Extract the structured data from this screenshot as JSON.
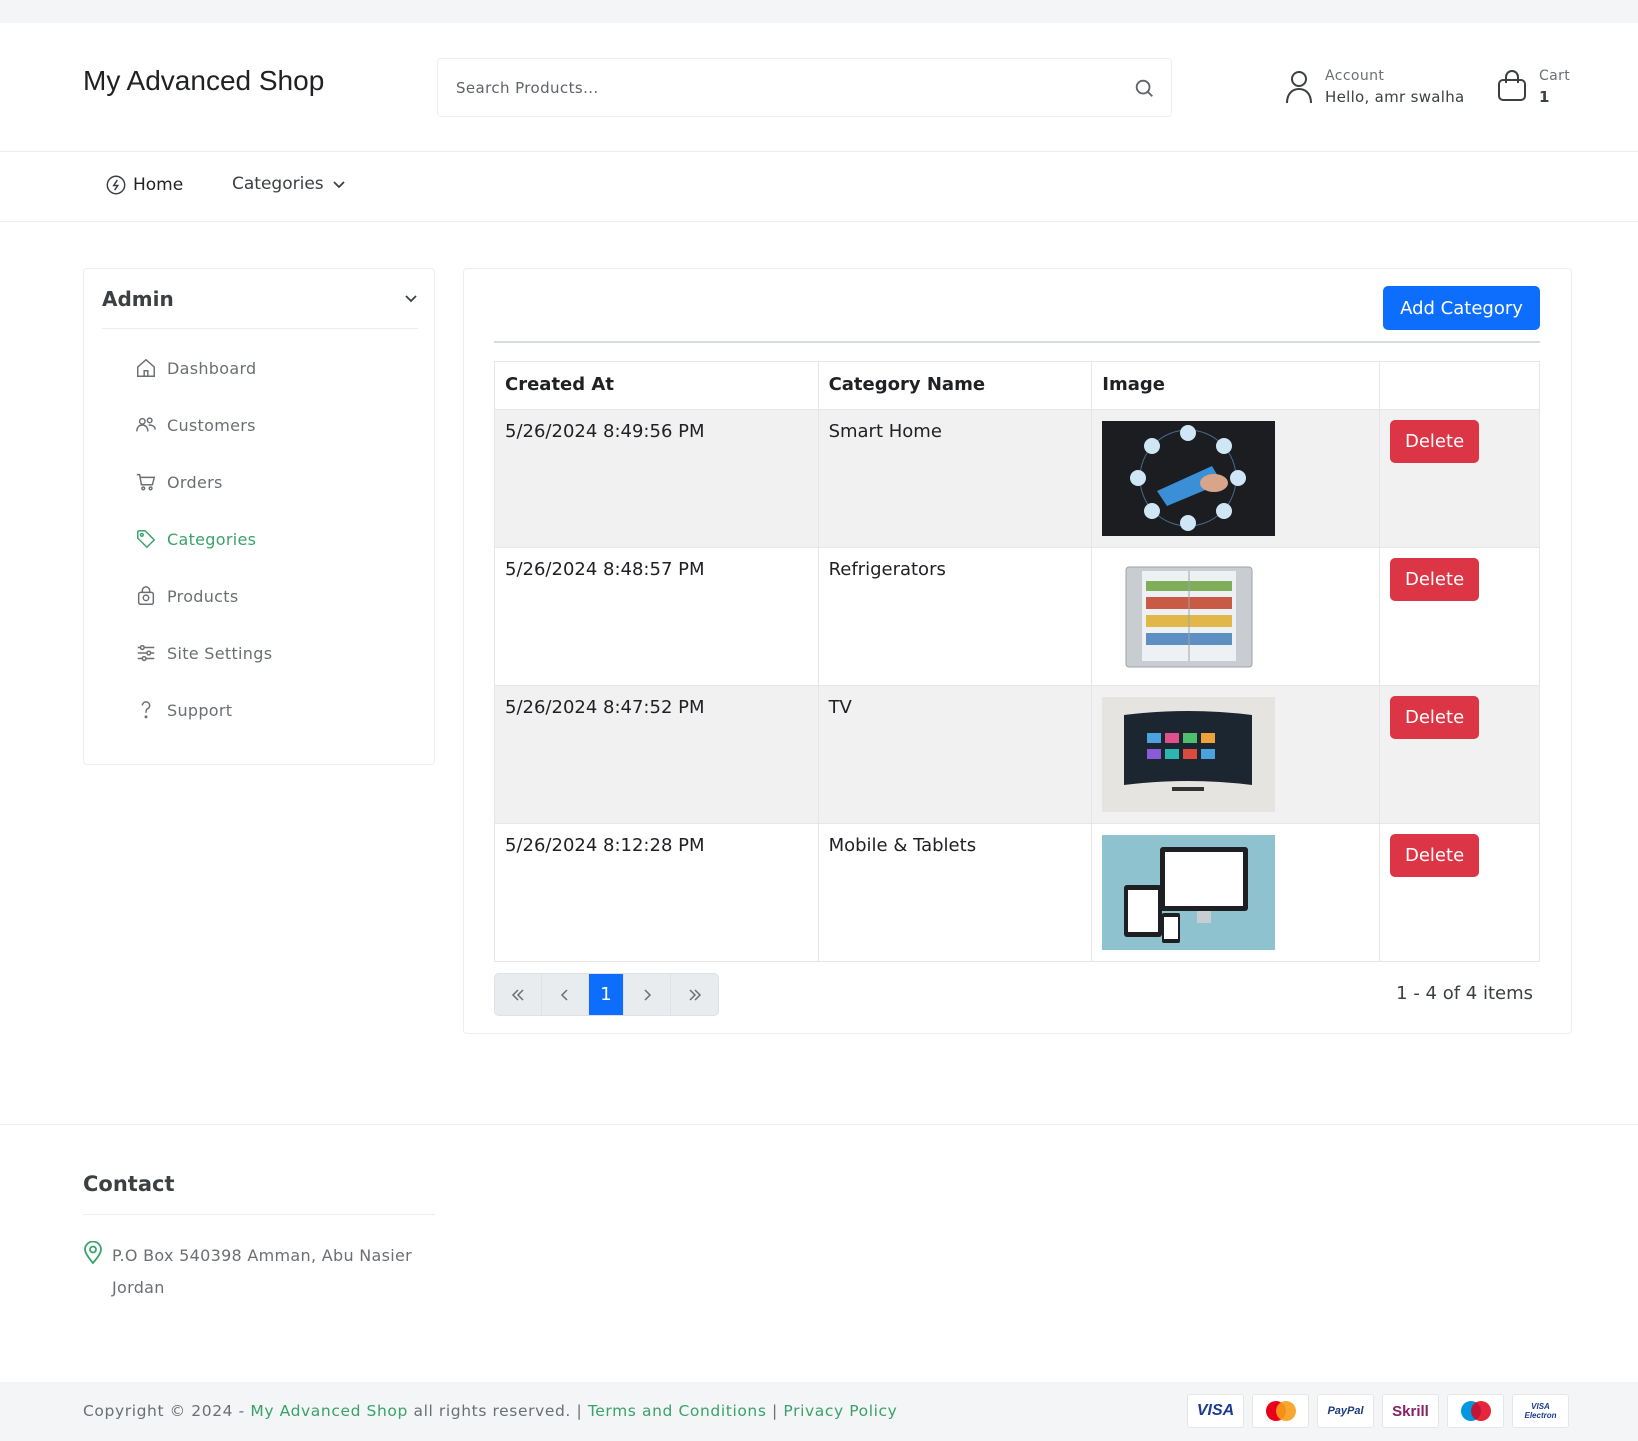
{
  "header": {
    "brand": "My Advanced Shop",
    "search_placeholder": "Search Products...",
    "account_label": "Account",
    "account_greeting": "Hello, amr swalha",
    "cart_label": "Cart",
    "cart_count": "1"
  },
  "nav": {
    "home": "Home",
    "categories": "Categories"
  },
  "sidebar": {
    "title": "Admin",
    "items": [
      {
        "label": "Dashboard",
        "icon": "home-icon"
      },
      {
        "label": "Customers",
        "icon": "users-icon"
      },
      {
        "label": "Orders",
        "icon": "cart-icon"
      },
      {
        "label": "Categories",
        "icon": "tag-icon",
        "active": true
      },
      {
        "label": "Products",
        "icon": "bag-icon"
      },
      {
        "label": "Site Settings",
        "icon": "sliders-icon"
      },
      {
        "label": "Support",
        "icon": "question-icon"
      }
    ]
  },
  "main": {
    "add_button": "Add Category",
    "columns": [
      "Created At",
      "Category Name",
      "Image",
      ""
    ],
    "rows": [
      {
        "created_at": "5/26/2024 8:49:56 PM",
        "name": "Smart Home",
        "image": "smart-home-image",
        "action": "Delete"
      },
      {
        "created_at": "5/26/2024 8:48:57 PM",
        "name": "Refrigerators",
        "image": "refrigerator-image",
        "action": "Delete"
      },
      {
        "created_at": "5/26/2024 8:47:52 PM",
        "name": "TV",
        "image": "tv-image",
        "action": "Delete"
      },
      {
        "created_at": "5/26/2024 8:12:28 PM",
        "name": "Mobile & Tablets",
        "image": "devices-image",
        "action": "Delete"
      }
    ],
    "pager": {
      "current_page": "1",
      "info": "1 - 4 of 4 items"
    }
  },
  "footer": {
    "contact_title": "Contact",
    "address_line1": "P.O Box 540398 Amman, Abu Nasier",
    "address_line2": "Jordan",
    "copyright_prefix": "Copyright © 2024 - ",
    "copyright_brand": "My Advanced Shop",
    "copyright_suffix": " all rights reserved. | ",
    "terms": "Terms and Conditions",
    "separator": " | ",
    "privacy": "Privacy Policy",
    "payments": [
      "VISA",
      "MasterCard",
      "PayPal",
      "Skrill",
      "Maestro",
      "VISA Electron"
    ]
  },
  "colors": {
    "primary": "#0d6efd",
    "danger": "#dc3545",
    "accent_green": "#3aa26a"
  }
}
